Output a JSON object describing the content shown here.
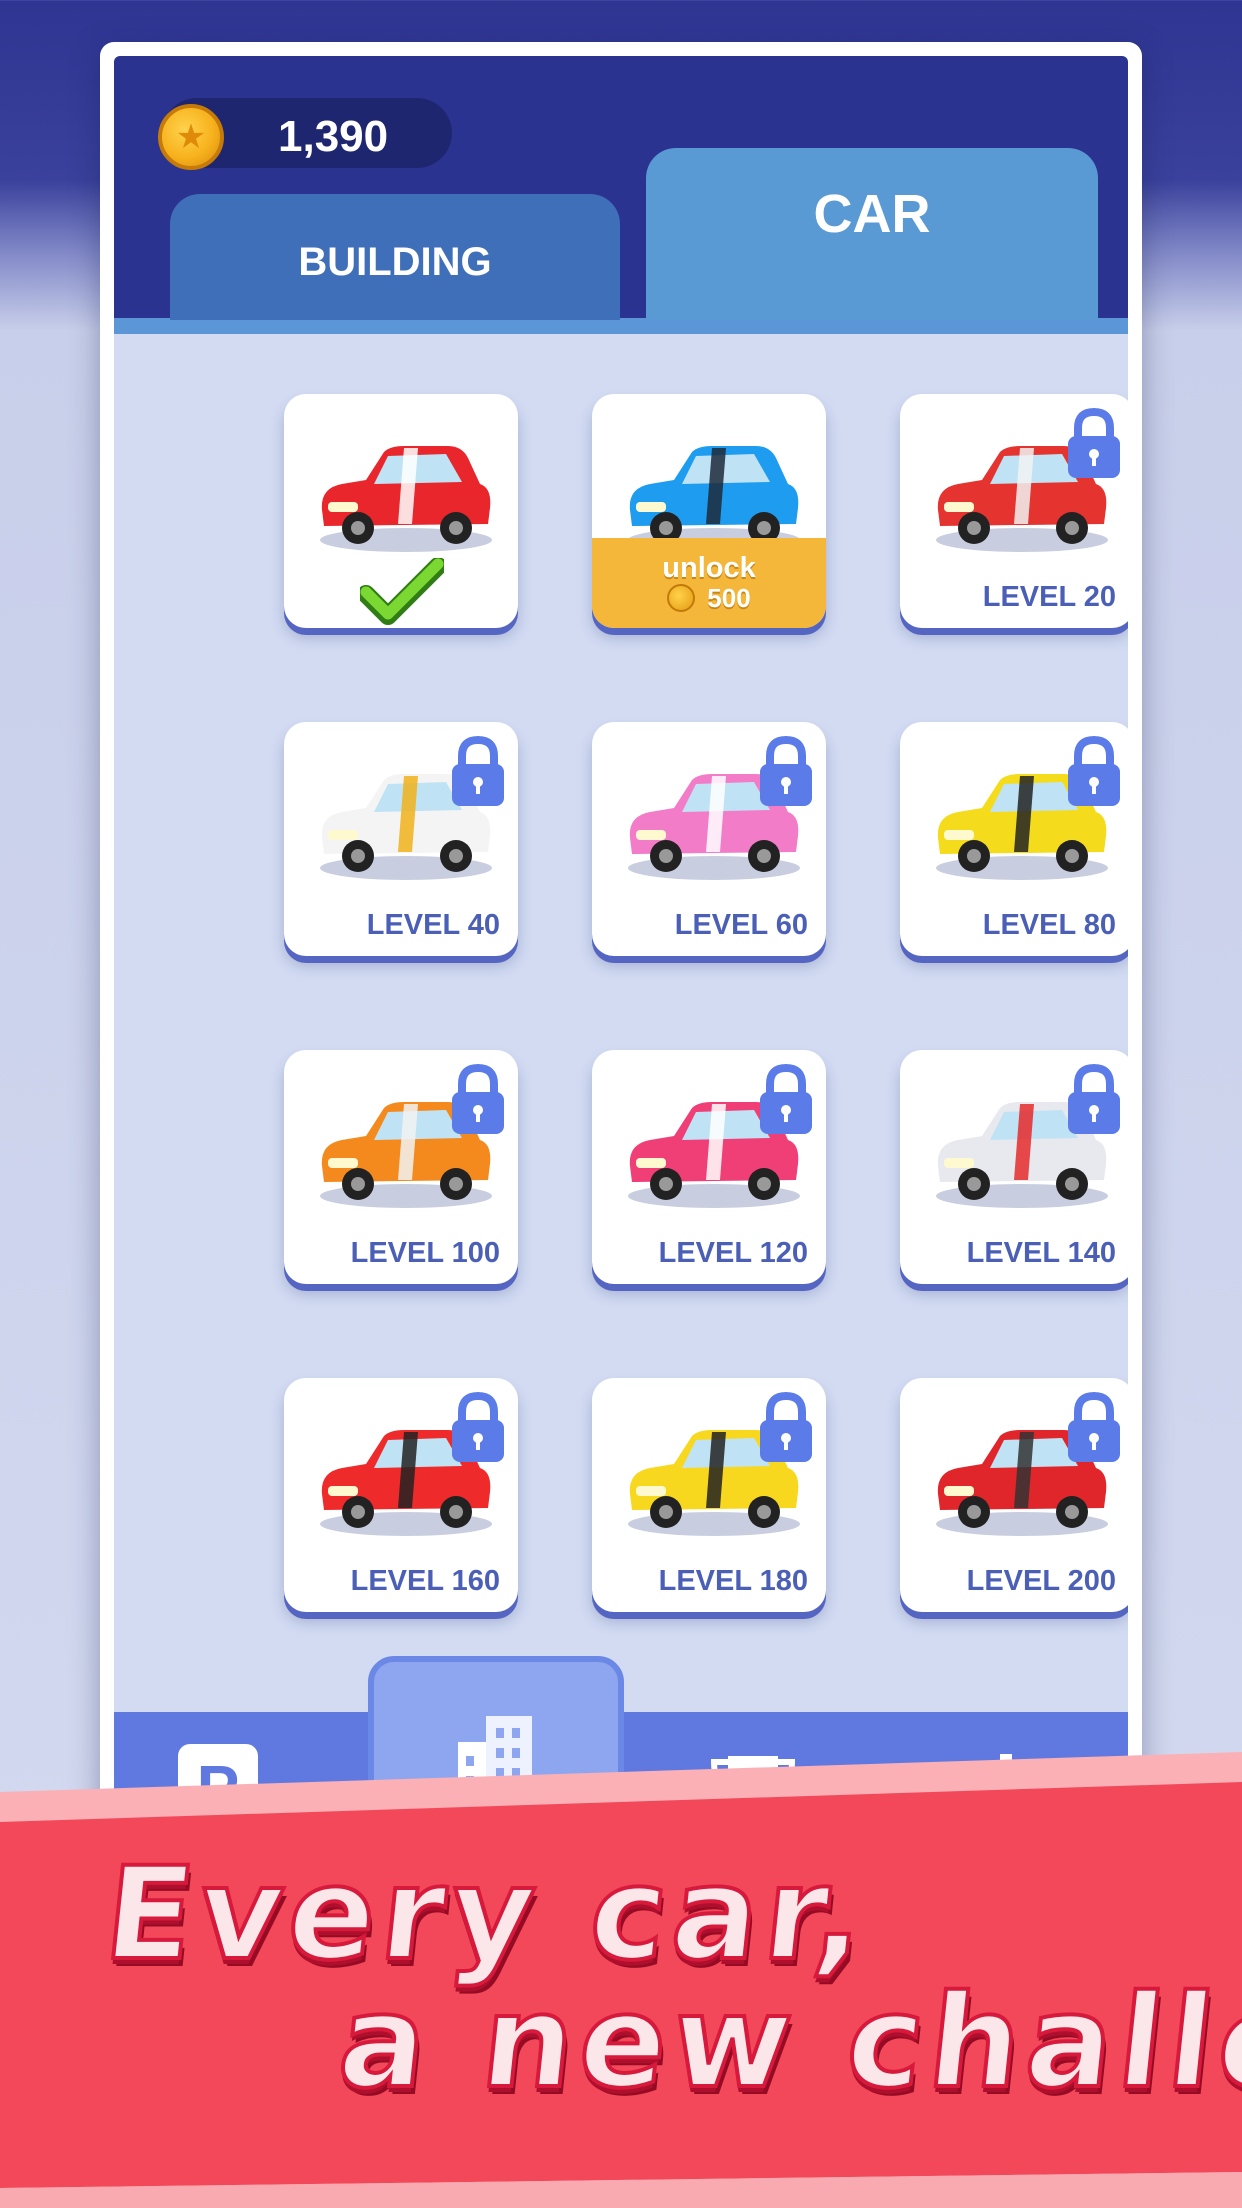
{
  "header": {
    "coins": "1,390",
    "tabs": [
      {
        "label": "BUILDING",
        "active": false
      },
      {
        "label": "CAR",
        "active": true
      }
    ]
  },
  "cars": [
    {
      "name": "red-hatchback",
      "status": "selected",
      "colors": [
        "#e8262b",
        "#ffffff"
      ]
    },
    {
      "name": "blue-supercar",
      "status": "purchasable",
      "unlock_label": "unlock",
      "price": "500",
      "colors": [
        "#1d9cf0",
        "#1e2a3a"
      ]
    },
    {
      "name": "red-classic",
      "status": "locked",
      "level": "LEVEL 20",
      "colors": [
        "#e53330",
        "#f2f2f2"
      ]
    },
    {
      "name": "taxi-racer",
      "status": "locked",
      "level": "LEVEL 40",
      "colors": [
        "#f4f4f4",
        "#f0b21a"
      ]
    },
    {
      "name": "pink-cadillac",
      "status": "locked",
      "level": "LEVEL 60",
      "colors": [
        "#f27cc8",
        "#ffffff"
      ]
    },
    {
      "name": "yellow-muscle",
      "status": "locked",
      "level": "LEVEL 80",
      "colors": [
        "#f4dc1c",
        "#222222"
      ]
    },
    {
      "name": "orange-van",
      "status": "locked",
      "level": "LEVEL 100",
      "colors": [
        "#f48a1e",
        "#f2f2f2"
      ]
    },
    {
      "name": "pink-mini",
      "status": "locked",
      "level": "LEVEL 120",
      "colors": [
        "#f03e76",
        "#ffffff"
      ]
    },
    {
      "name": "silver-coupe",
      "status": "locked",
      "level": "LEVEL 140",
      "colors": [
        "#e8e8ef",
        "#e52a2a"
      ]
    },
    {
      "name": "red-convertible",
      "status": "locked",
      "level": "LEVEL 160",
      "colors": [
        "#ee2a2a",
        "#222222"
      ]
    },
    {
      "name": "yellow-rally",
      "status": "locked",
      "level": "LEVEL 180",
      "colors": [
        "#f8d81f",
        "#222222"
      ]
    },
    {
      "name": "red-hotrod",
      "status": "locked",
      "level": "LEVEL 200",
      "colors": [
        "#e0262a",
        "#333333"
      ]
    }
  ],
  "nav": {
    "items": [
      {
        "icon": "parking-icon",
        "active": false
      },
      {
        "icon": "building-icon",
        "active": true
      },
      {
        "icon": "trophy-icon",
        "active": false
      },
      {
        "icon": "gear-icon",
        "active": false
      }
    ]
  },
  "banner": {
    "line1": "Every car,",
    "line2": "a new challenge"
  },
  "colors": {
    "header_bg": "#2b3390",
    "tab_active": "#5a9ad4",
    "tab_inactive": "#3f6fb8",
    "grid_bg": "#d2dbf2",
    "level_text": "#4a5fb5",
    "lock": "#5b7ce8",
    "unlock_bg": "#f5b73a",
    "banner_red": "#f3485a"
  }
}
